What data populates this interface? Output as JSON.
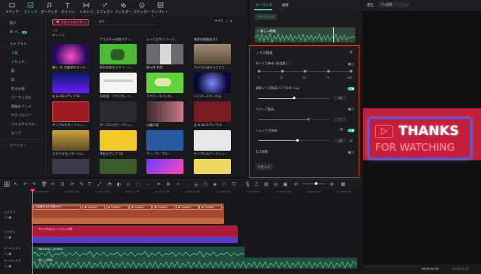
{
  "toolbar": {
    "items": [
      {
        "label": "メディア",
        "icon": "media-icon"
      },
      {
        "label": "ストック",
        "icon": "stock-icon"
      },
      {
        "label": "オーディオ",
        "icon": "music-icon"
      },
      {
        "label": "タイトル",
        "icon": "title-icon"
      },
      {
        "label": "トランジ",
        "icon": "transition-icon"
      },
      {
        "label": "エフェクト",
        "icon": "effect-icon"
      },
      {
        "label": "フィルター",
        "icon": "filter-icon"
      },
      {
        "label": "ステッカー",
        "icon": "sticker-icon"
      },
      {
        "label": "テンプレート",
        "icon": "template-icon"
      }
    ],
    "active_index": 1
  },
  "sidebar": {
    "items": [
      {
        "label": "個人",
        "chevron": "›",
        "level": 0
      },
      {
        "label": "AI メ..",
        "chevron": "›",
        "level": 0,
        "badge": "AI"
      },
      {
        "label": "ライブラリ",
        "chevron": "⌄",
        "level": 0
      },
      {
        "label": "人気",
        "level": 1,
        "active": true
      },
      {
        "label": "ソリッド...",
        "level": 1
      },
      {
        "label": "黒",
        "level": 1
      },
      {
        "label": "白",
        "level": 1
      },
      {
        "label": "花火大会",
        "level": 1
      },
      {
        "label": "パーティクル",
        "level": 1
      },
      {
        "label": "漫画＆アニメ",
        "level": 1
      },
      {
        "label": "テクノロジー",
        "level": 1
      },
      {
        "label": "フェスティバル...",
        "level": 1
      },
      {
        "label": "ループ",
        "level": 1
      },
      {
        "label": "パートナー",
        "chevron": "›",
        "level": 0
      }
    ]
  },
  "assets": {
    "tab_label": "アセットセンター",
    "search_placeholder": "検索",
    "filter_label": "すべて",
    "group_popular": "人気",
    "group_orange": "オレンジ",
    "captions": [
      "輝く SF 別惑星のホール...",
      "緑の背景のスクリーン...",
      "防火扉 緊急",
      "カメラに向かってとて...",
      "炎 & BGメディア10",
      "日本語、マウスカーソ...",
      "スクロールバーの...",
      "ハイパースペースは...",
      "サンプルカラーソリッ...",
      "サンプルカラーソリッ...",
      "公園の桜",
      "炎 & BGメディア12",
      "スタジオモンタージュ...",
      "単色メディア 24",
      "ディープ・ブルー",
      "サンプルカラーソリッ..."
    ],
    "top_captions": [
      "テクスチャ背景メディ...",
      "レトロなサイバーパ...",
      "風景背景動画 03"
    ]
  },
  "panel": {
    "tabs": [
      "オーディオ",
      "速度"
    ],
    "basic_label": "ベーシック",
    "clip_name": "楽しい時間",
    "noise_title": "ノイズ除去",
    "ai_noise_label": "AIノイズ除去 (高品質)",
    "ai_scale": [
      "0",
      "25",
      "50",
      "75",
      "100"
    ],
    "normal_noise_label": "通常ノイズ除去 (リアルタイム)",
    "normal_noise_value": "50",
    "reverb_label": "リバーブ除去",
    "reverb_value": "70",
    "hum_label": "ハムノイズ除去",
    "hum_value": "-31",
    "hum_unit": "dB",
    "hiss_label": "ヒス除去",
    "reset_label": "リセット"
  },
  "toggles": {
    "ai_noise": false,
    "normal_noise": true,
    "reverb": false,
    "hum": true,
    "hiss": false
  },
  "sliders": {
    "normal_noise": 0.5,
    "reverb": 0.7,
    "hum": 0.55
  },
  "preview": {
    "tab_label": "再生",
    "quality_label": "フル品質",
    "thanks_line1": "THANKS",
    "thanks_line2": "FOR WATCHING",
    "time_current": "00:00:00:00",
    "time_total": "00:05:55:21"
  },
  "timeline": {
    "ruler": [
      "00:00:00:00",
      "00:00:05:00",
      "00:00:10:00",
      "00:00:15:00",
      "00:00:20:00",
      "00:00:25:00",
      "00:00:30:00",
      "00:00:35:00",
      "00:00:40:00",
      "00:00:45:00",
      "00:00:50:00"
    ],
    "tracks": [
      "ビデオ 2",
      "ビデオ 1",
      "オーディオ 1",
      "オーディオ 2"
    ],
    "title_clip_label": "字幕体Ｗ(台の背景/\\Nモ...",
    "thanks_label": "THANKS",
    "solid_clip_label": "サンプルカラーソリッド08",
    "narration_label": "Narration_childlik...",
    "music_label": "楽しい時間"
  }
}
